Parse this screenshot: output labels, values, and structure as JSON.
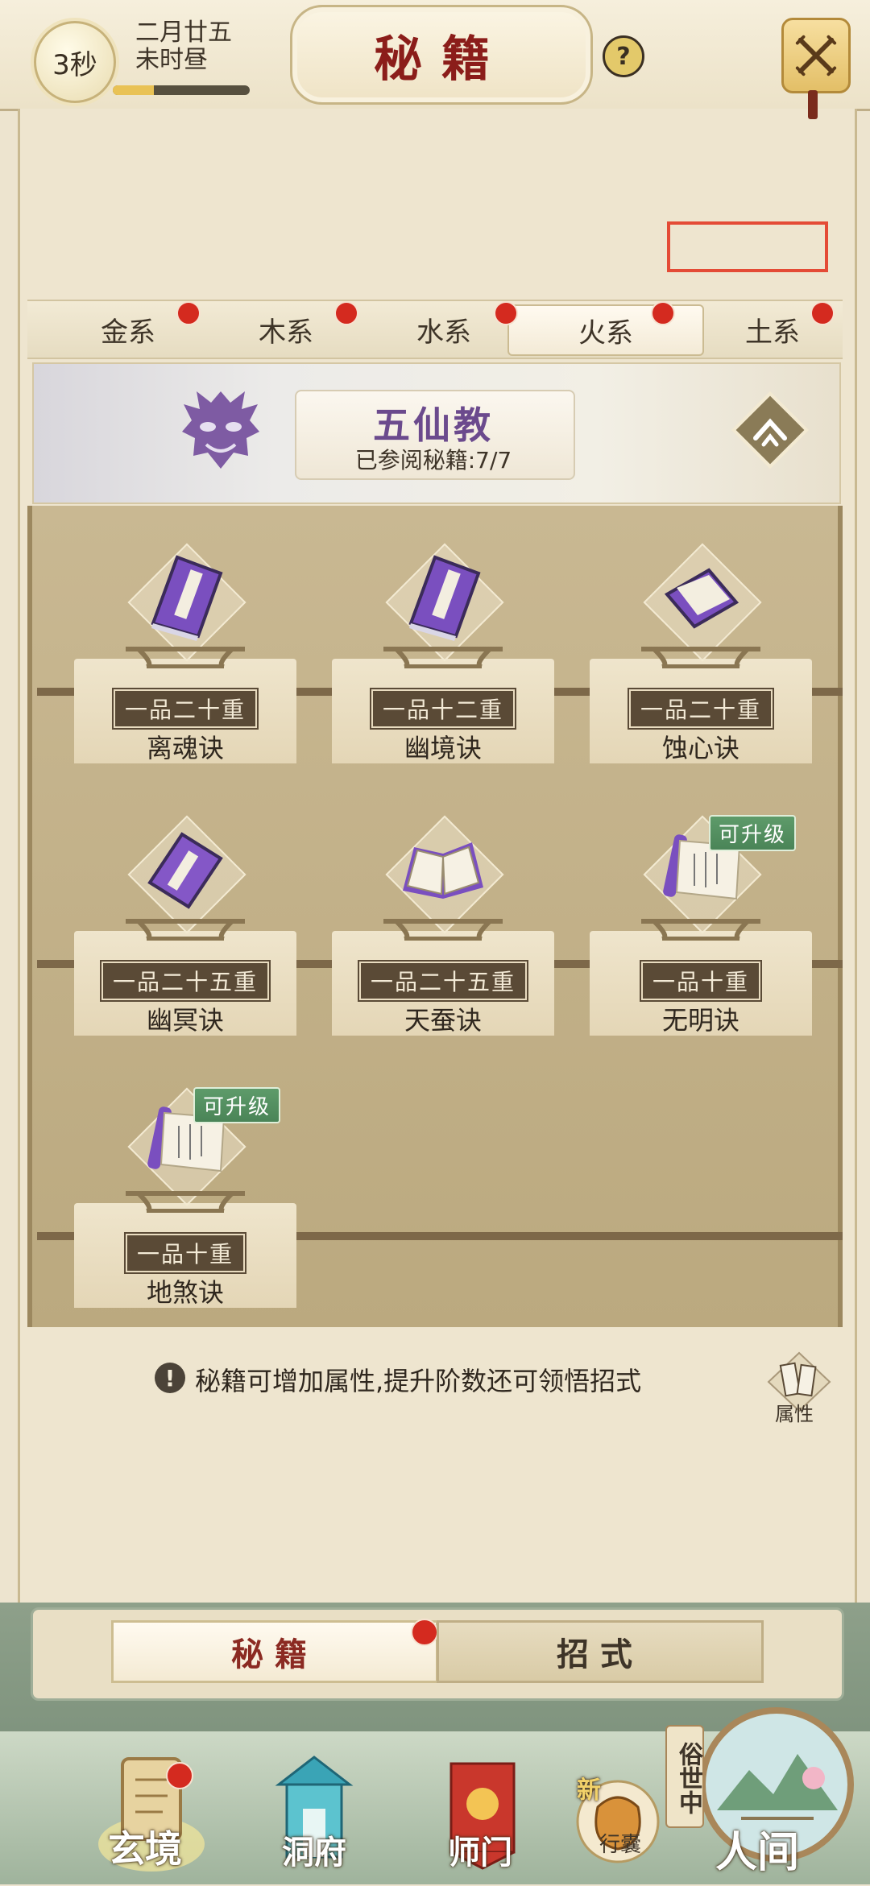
{
  "header": {
    "timer": "3秒",
    "date_line1": "二月廿五",
    "date_line2": "未时昼",
    "progress": 0.3,
    "title": "秘籍",
    "help": "?"
  },
  "element_tabs": [
    {
      "label": "金系",
      "dot": true
    },
    {
      "label": "木系",
      "dot": true
    },
    {
      "label": "水系",
      "dot": true
    },
    {
      "label": "火系",
      "dot": true,
      "active": true
    },
    {
      "label": "土系",
      "dot": true
    }
  ],
  "sect": {
    "name": "五仙教",
    "count": "已参阅秘籍:7/7"
  },
  "books": [
    {
      "rank": "一品二十重",
      "name": "离魂诀",
      "badge": ""
    },
    {
      "rank": "一品十二重",
      "name": "幽境诀",
      "badge": ""
    },
    {
      "rank": "一品二十重",
      "name": "蚀心诀",
      "badge": ""
    },
    {
      "rank": "一品二十五重",
      "name": "幽冥诀",
      "badge": ""
    },
    {
      "rank": "一品二十五重",
      "name": "天蚕诀",
      "badge": ""
    },
    {
      "rank": "一品十重",
      "name": "无明诀",
      "badge": "可升级"
    },
    {
      "rank": "一品十重",
      "name": "地煞诀",
      "badge": "可升级"
    }
  ],
  "info": {
    "icon": "!",
    "text": "秘籍可增加属性,提升阶数还可领悟招式",
    "attr_label": "属性"
  },
  "section_tabs": {
    "left": "秘籍",
    "right": "招式"
  },
  "nav": {
    "xuanjing": "玄境",
    "dongfu": "洞府",
    "shimen": "师门",
    "xingnang": "行囊",
    "new": "新",
    "sushi": "俗世中",
    "renjian": "人间"
  },
  "colors": {
    "accent_red": "#8b1d1a",
    "dot_red": "#d42a1f",
    "badge_green": "#4a8457",
    "sect_purple": "#6b4a8d"
  }
}
